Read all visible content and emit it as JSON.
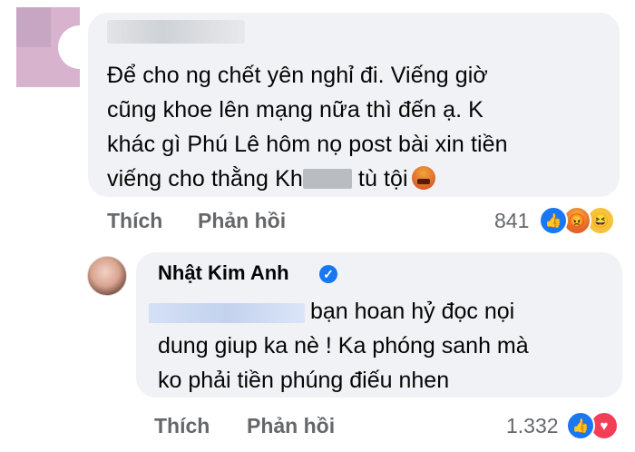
{
  "comment1": {
    "text_line1": "Để cho ng chết yên nghỉ đi. Viếng giờ",
    "text_line2": "cũng khoe lên mạng nữa thì đến ạ. K",
    "text_line3": "khác gì Phú Lê hôm nọ post bài xin tiền",
    "text_line4_before": "viếng cho thằng Kh",
    "text_line4_after": " tù tội",
    "like_label": "Thích",
    "reply_label": "Phản hồi",
    "reaction_count": "841",
    "reactions": [
      "like-icon",
      "angry-icon",
      "haha-icon"
    ]
  },
  "reply": {
    "author": "Nhật Kim Anh",
    "text_line1": "bạn hoan hỷ đọc nọi",
    "text_line2": "dung giup ka nè ! Ka phóng sanh mà",
    "text_line3": "ko phải tiền phúng điếu nhen",
    "like_label": "Thích",
    "reply_label": "Phản hồi",
    "reaction_count": "1.332",
    "reactions": [
      "like-icon",
      "heart-icon"
    ]
  },
  "colors": {
    "bubble": "#f0f2f5",
    "secondary_text": "#65676b",
    "like_blue": "#1877f2",
    "heart_red": "#f33e58"
  }
}
